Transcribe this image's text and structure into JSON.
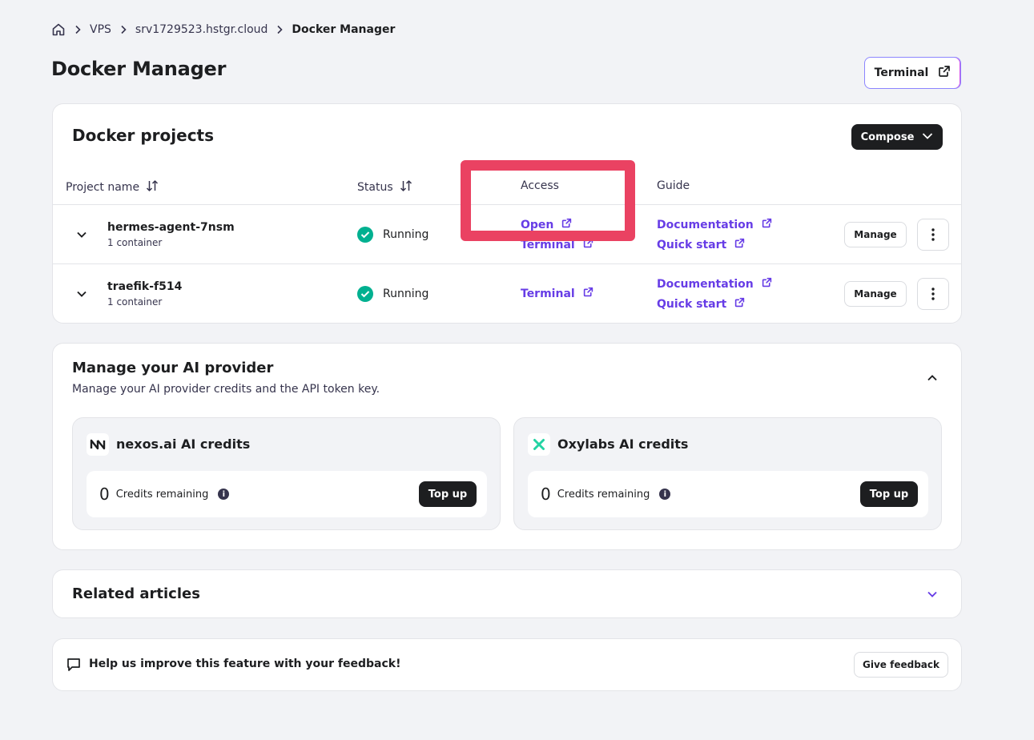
{
  "breadcrumb": {
    "items": [
      "VPS",
      "srv1729523.hstgr.cloud",
      "Docker Manager"
    ]
  },
  "page": {
    "title": "Docker Manager",
    "terminal_button": "Terminal"
  },
  "projects": {
    "title": "Docker projects",
    "compose_label": "Compose",
    "columns": {
      "name": "Project name",
      "status": "Status",
      "access": "Access",
      "guide": "Guide"
    },
    "rows": [
      {
        "name": "hermes-agent-7nsm",
        "containers": "1 container",
        "status": "Running",
        "access": [
          "Open",
          "Terminal"
        ],
        "guide": [
          "Documentation",
          "Quick start"
        ],
        "manage": "Manage"
      },
      {
        "name": "traefik-f514",
        "containers": "1 container",
        "status": "Running",
        "access": [
          "Terminal"
        ],
        "guide": [
          "Documentation",
          "Quick start"
        ],
        "manage": "Manage"
      }
    ]
  },
  "ai_provider": {
    "title": "Manage your AI provider",
    "subtitle": "Manage your AI provider credits and the API token key.",
    "providers": [
      {
        "title": "nexos.ai AI credits",
        "credits": "0",
        "credits_label": "Credits remaining",
        "action": "Top up",
        "icon": "nexos-logo-icon"
      },
      {
        "title": "Oxylabs AI credits",
        "credits": "0",
        "credits_label": "Credits remaining",
        "action": "Top up",
        "icon": "oxylabs-logo-icon"
      }
    ]
  },
  "related": {
    "title": "Related articles"
  },
  "feedback": {
    "text": "Help us improve this feature with your feedback!",
    "button": "Give feedback"
  },
  "colors": {
    "accent": "#673de6",
    "success": "#00b090",
    "highlight": "#ea4262",
    "background": "#f2f3f6"
  }
}
